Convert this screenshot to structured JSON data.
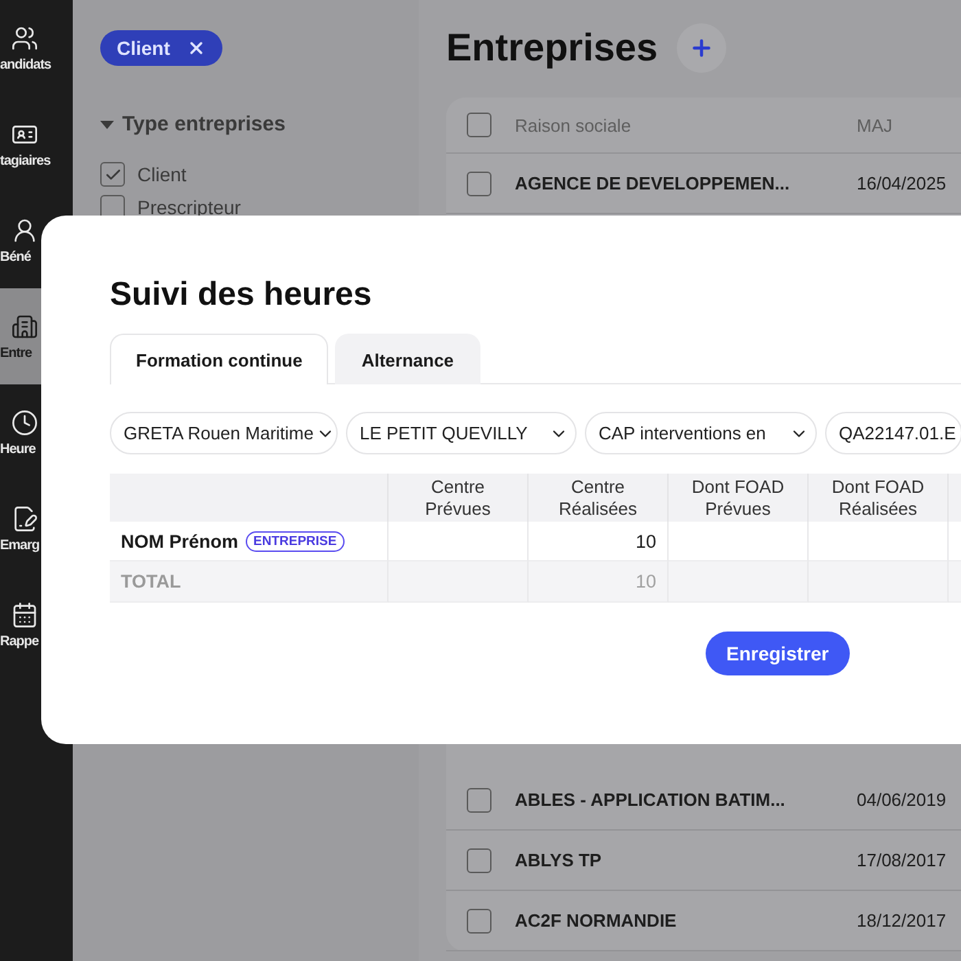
{
  "sidebar": {
    "items": [
      {
        "label": "andidats",
        "selected": false
      },
      {
        "label": "tagiaires",
        "selected": false
      },
      {
        "label": "Béné",
        "selected": false
      },
      {
        "label": "Entre",
        "selected": true
      },
      {
        "label": "Heure",
        "selected": false
      },
      {
        "label": "Emarg",
        "selected": false
      },
      {
        "label": "Rappe",
        "selected": false
      }
    ]
  },
  "filters": {
    "active_chips": [
      {
        "label": "Client"
      }
    ],
    "group": {
      "title": "Type entreprises",
      "expanded": true,
      "options": [
        {
          "label": "Client",
          "checked": true
        },
        {
          "label": "Prescripteur",
          "checked": false
        }
      ]
    }
  },
  "page": {
    "title": "Entreprises",
    "table": {
      "columns": [
        "Raison sociale",
        "MAJ"
      ],
      "all_checked": false,
      "rows": [
        {
          "name": "AGENCE DE DEVELOPPEMEN...",
          "date": "16/04/2025",
          "checked": false
        },
        {
          "name": "ABLES - APPLICATION BATIM...",
          "date": "04/06/2019",
          "checked": false
        },
        {
          "name": "ABLYS TP",
          "date": "17/08/2017",
          "checked": false
        },
        {
          "name": "AC2F NORMANDIE",
          "date": "18/12/2017",
          "checked": false
        }
      ]
    }
  },
  "dialog": {
    "title": "Suivi des heures",
    "tabs": [
      {
        "label": "Formation continue",
        "selected": true
      },
      {
        "label": "Alternance",
        "selected": false
      }
    ],
    "selects": [
      {
        "value": "GRETA Rouen Maritime"
      },
      {
        "value": "LE PETIT QUEVILLY"
      },
      {
        "value": "CAP interventions en"
      },
      {
        "value": "QA22147.01.E"
      }
    ],
    "table": {
      "columns": [
        "Centre Prévues",
        "Centre Réalisées",
        "Dont FOAD Prévues",
        "Dont FOAD Réalisées"
      ],
      "rows": [
        {
          "kind": "person",
          "name": "NOM Prénom",
          "badge": "ENTREPRISE",
          "cells": [
            "",
            "10",
            "",
            ""
          ]
        },
        {
          "kind": "total",
          "name": "TOTAL",
          "cells": [
            "",
            "10",
            "",
            ""
          ]
        }
      ]
    },
    "save_button": "Enregistrer"
  }
}
